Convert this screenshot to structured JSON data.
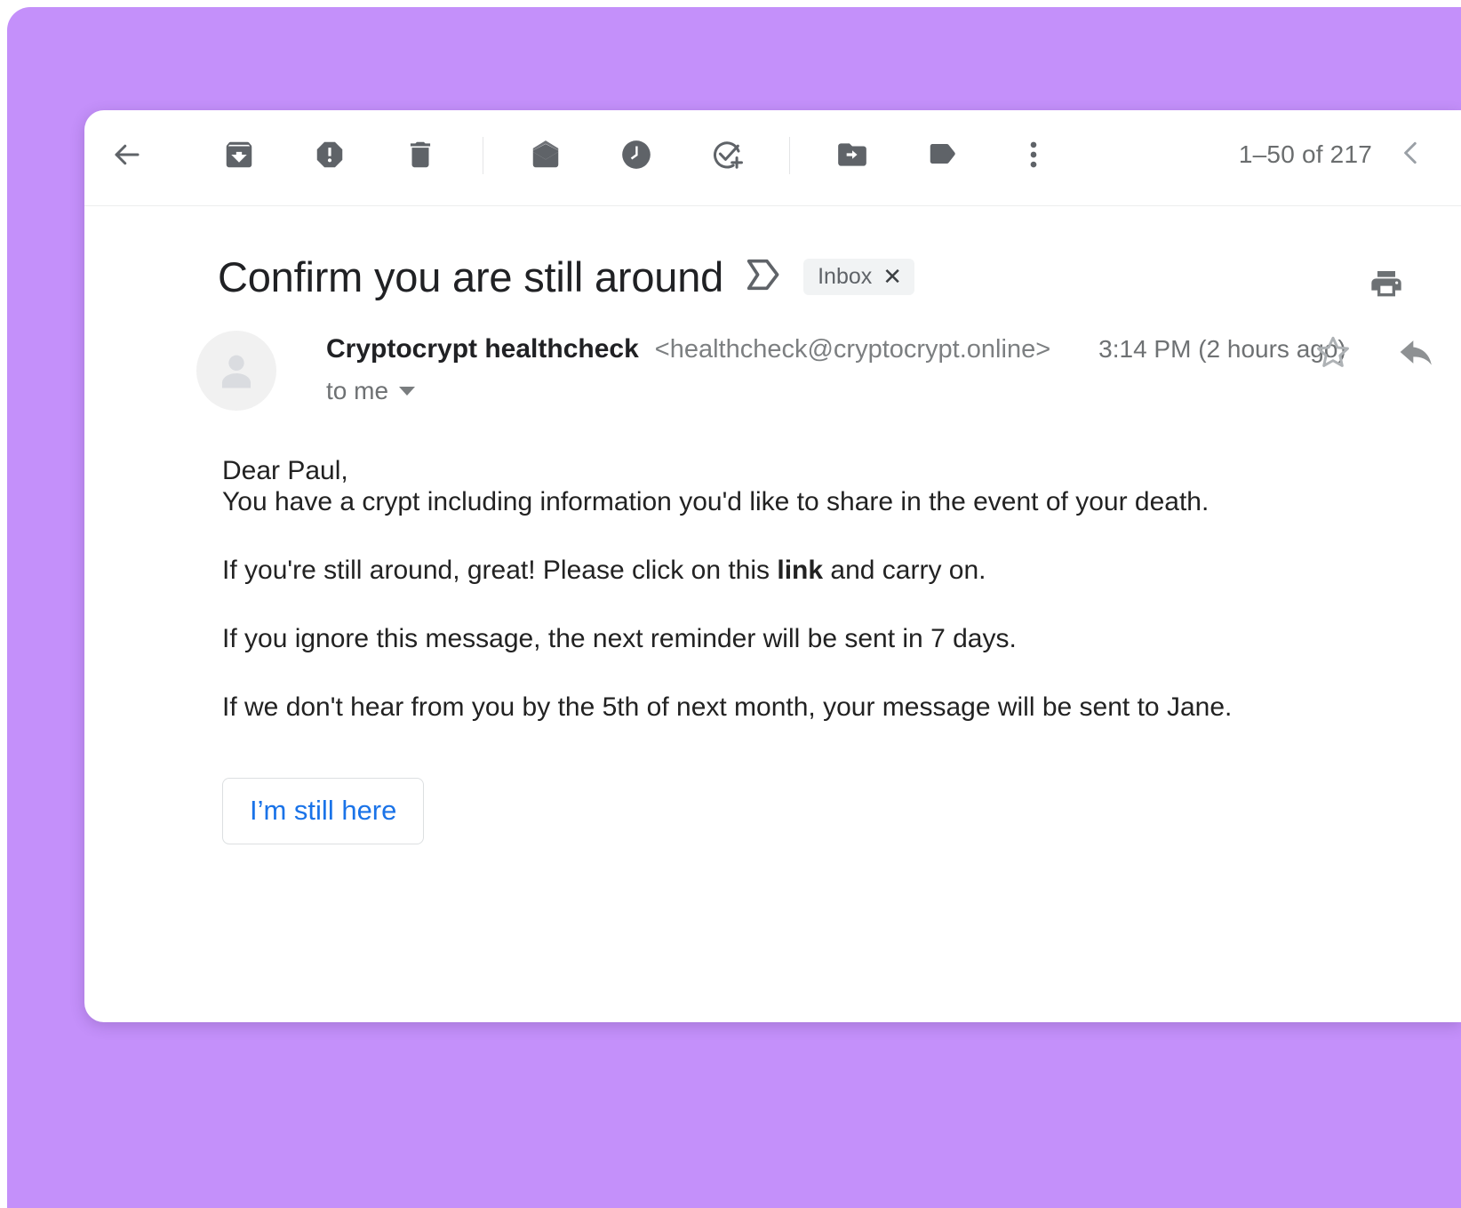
{
  "theme": {
    "backdrop_color": "#c490fa",
    "card_color": "#ffffff",
    "accent_link_color": "#1a73e8",
    "icon_color": "#5f6368"
  },
  "toolbar": {
    "back_label": "Back to inbox",
    "buttons": [
      {
        "name": "archive",
        "label": "Archive"
      },
      {
        "name": "report-spam",
        "label": "Report spam"
      },
      {
        "name": "delete",
        "label": "Delete"
      },
      {
        "name": "mark-unread",
        "label": "Mark as unread"
      },
      {
        "name": "snooze",
        "label": "Snooze"
      },
      {
        "name": "add-to-tasks",
        "label": "Add to tasks"
      },
      {
        "name": "move-to",
        "label": "Move to"
      },
      {
        "name": "labels",
        "label": "Labels"
      },
      {
        "name": "more",
        "label": "More"
      }
    ],
    "count_label": "1–50 of 217",
    "pager_prev_label": "Newer"
  },
  "subject": {
    "title": "Confirm you are still around",
    "importance_marker_label": "Marked as important",
    "label_chip": "Inbox",
    "label_chip_remove": "✕",
    "print_label": "Print all"
  },
  "sender": {
    "name": "Cryptocrypt healthcheck",
    "email": "<healthcheck@cryptocrypt.online>",
    "timestamp": "3:14 PM  (2 hours ago)",
    "recipient": "to me",
    "star_label": "Not starred",
    "reply_label": "Reply"
  },
  "body": {
    "greeting": "Dear Paul,",
    "intro": "You have a crypt including information you'd like to share in the event of your death.",
    "para_link_pre": "If you're still around, great! Please click on this ",
    "para_link_word": "link",
    "para_link_post": " and carry on.",
    "para_ignore": "If you ignore this message, the next reminder will be sent in 7 days.",
    "para_deadline": "If we don't hear from you by the 5th of next month, your message will be sent to Jane.",
    "cta_label": "I’m still here"
  }
}
